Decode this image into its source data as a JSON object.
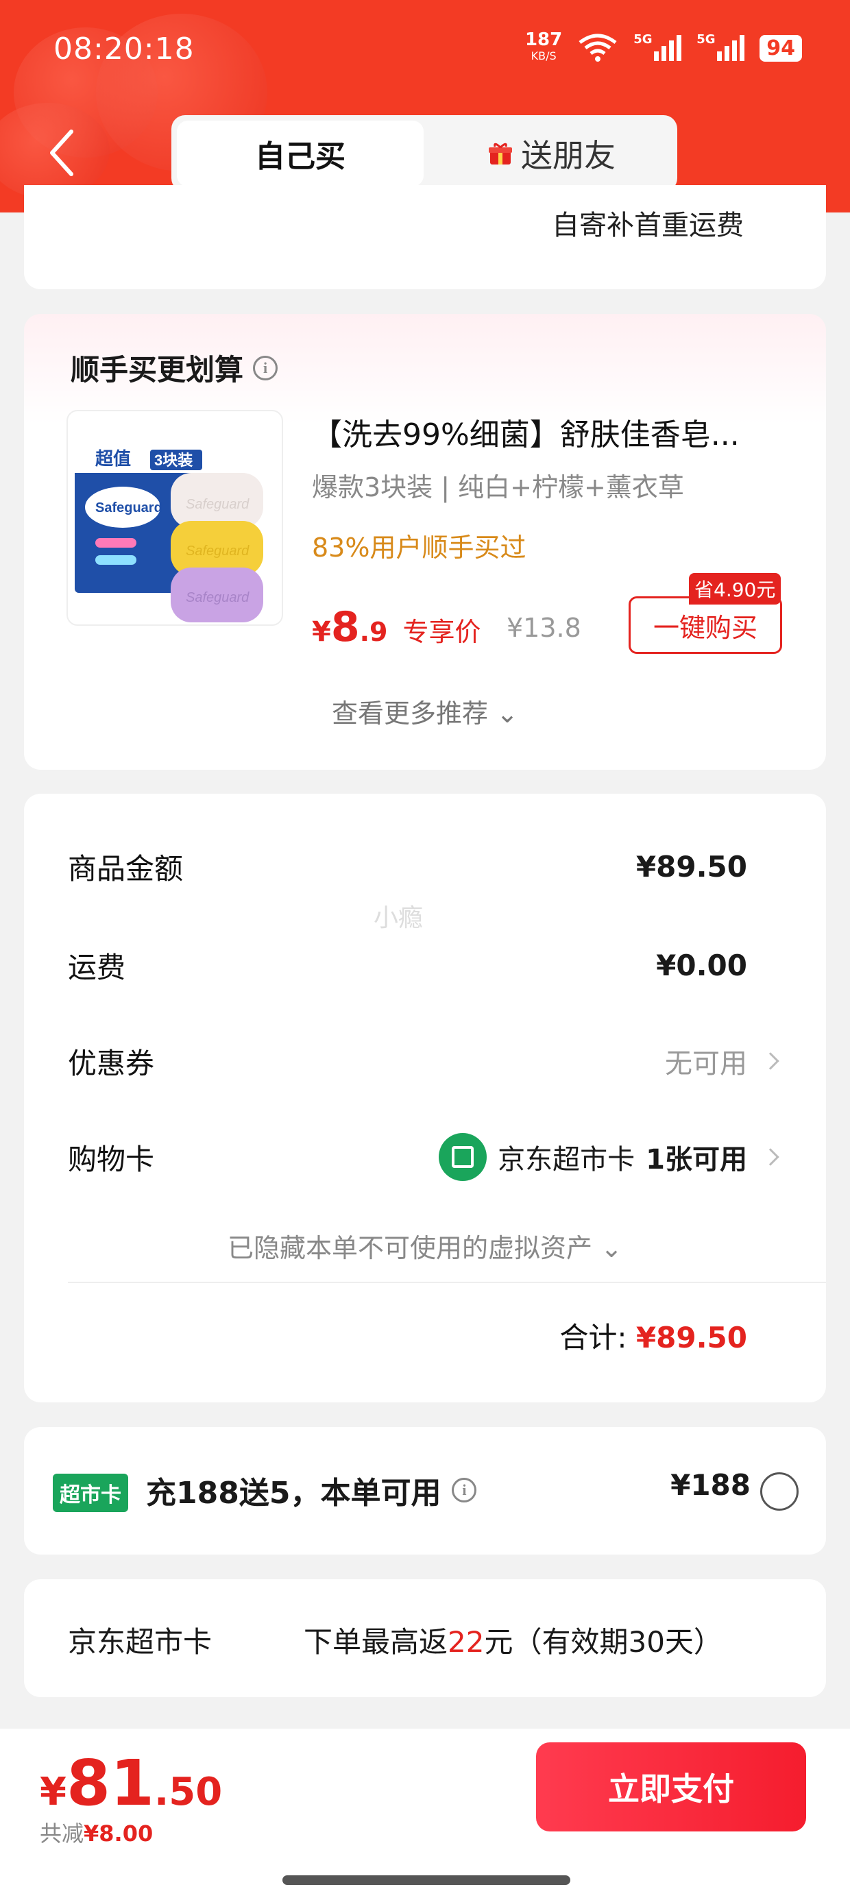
{
  "status_bar": {
    "time": "08:20:18",
    "net_speed": "187",
    "net_unit": "KB/S",
    "sig1_label": "5G",
    "sig2_label": "5G",
    "battery": "94"
  },
  "header": {
    "tab_self": "自己买",
    "tab_gift": "送朋友"
  },
  "top_card": {
    "text": "自寄补首重运费"
  },
  "recommend": {
    "title": "顺手买更划算",
    "product_name": "【洗去99%细菌】舒肤佳香皂...",
    "spec": "爆款3块装 | 纯白+柠檬+薰衣草",
    "hot": "83%用户顺手买过",
    "price_currency": "¥",
    "price_int": "8",
    "price_dec": ".9",
    "price_tag": "专享价",
    "original_price": "¥13.8",
    "save_badge": "省4.90元",
    "buy_button": "一键购买",
    "more": "查看更多推荐 ⌄",
    "image_text_1": "超值",
    "image_text_2": "3块装",
    "image_brand": "Safeguard"
  },
  "summary": {
    "goods_label": "商品金额",
    "goods_value": "¥89.50",
    "shipping_label": "运费",
    "shipping_value": "¥0.00",
    "coupon_label": "优惠券",
    "coupon_value": "无可用",
    "card_label": "购物卡",
    "card_name": "京东超市卡",
    "card_avail": "1张可用",
    "hidden_tip": "已隐藏本单不可使用的虚拟资产 ⌄",
    "total_label": "合计:",
    "total_value": "¥89.50",
    "watermark": "小瘾"
  },
  "market_card": {
    "badge": "超市卡",
    "text": "充188送5，本单可用",
    "price": "¥188"
  },
  "jd_card": {
    "label": "京东超市卡",
    "text_prefix": "下单最高返",
    "text_num": "22",
    "text_suffix": "元（有效期30天）"
  },
  "bottom_bar": {
    "currency": "¥",
    "pay_int": "81",
    "pay_dec": ".50",
    "saved_label": "共减",
    "saved_value": "¥8.00",
    "pay_button": "立即支付"
  },
  "colors": {
    "brand_red": "#f33b24",
    "price_red": "#e4231f",
    "jd_green": "#1aa55b"
  }
}
